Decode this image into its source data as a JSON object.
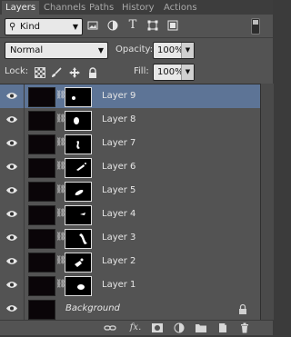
{
  "tabs": [
    {
      "label": "Layers",
      "active": true
    },
    {
      "label": "Channels",
      "active": false
    },
    {
      "label": "Paths",
      "active": false
    },
    {
      "label": "History",
      "active": false
    },
    {
      "label": "Actions",
      "active": false
    }
  ],
  "filter": {
    "kind_value": "Kind",
    "icons": [
      "image-filter-icon",
      "adjustment-filter-icon",
      "type-filter-icon",
      "shape-filter-icon",
      "smart-object-filter-icon"
    ]
  },
  "blend": {
    "mode_value": "Normal",
    "opacity_label": "Opacity:",
    "opacity_value": "100%"
  },
  "lock": {
    "label": "Lock:",
    "fill_label": "Fill:",
    "fill_value": "100%"
  },
  "layers": [
    {
      "name": "Layer 9",
      "selected": true
    },
    {
      "name": "Layer 8",
      "selected": false
    },
    {
      "name": "Layer 7",
      "selected": false
    },
    {
      "name": "Layer 6",
      "selected": false
    },
    {
      "name": "Layer 5",
      "selected": false
    },
    {
      "name": "Layer 4",
      "selected": false
    },
    {
      "name": "Layer 3",
      "selected": false
    },
    {
      "name": "Layer 2",
      "selected": false
    },
    {
      "name": "Layer 1",
      "selected": false
    },
    {
      "name": "Background",
      "selected": false,
      "locked": true
    }
  ],
  "bottom_toolbar": {
    "fx_label": "fx.",
    "icons": [
      "link-layers-icon",
      "fx-icon",
      "add-mask-icon",
      "adjustment-layer-icon",
      "new-group-icon",
      "new-layer-icon",
      "trash-icon"
    ]
  },
  "colors": {
    "panel": "#535353",
    "selected_row": "#5d7496"
  }
}
